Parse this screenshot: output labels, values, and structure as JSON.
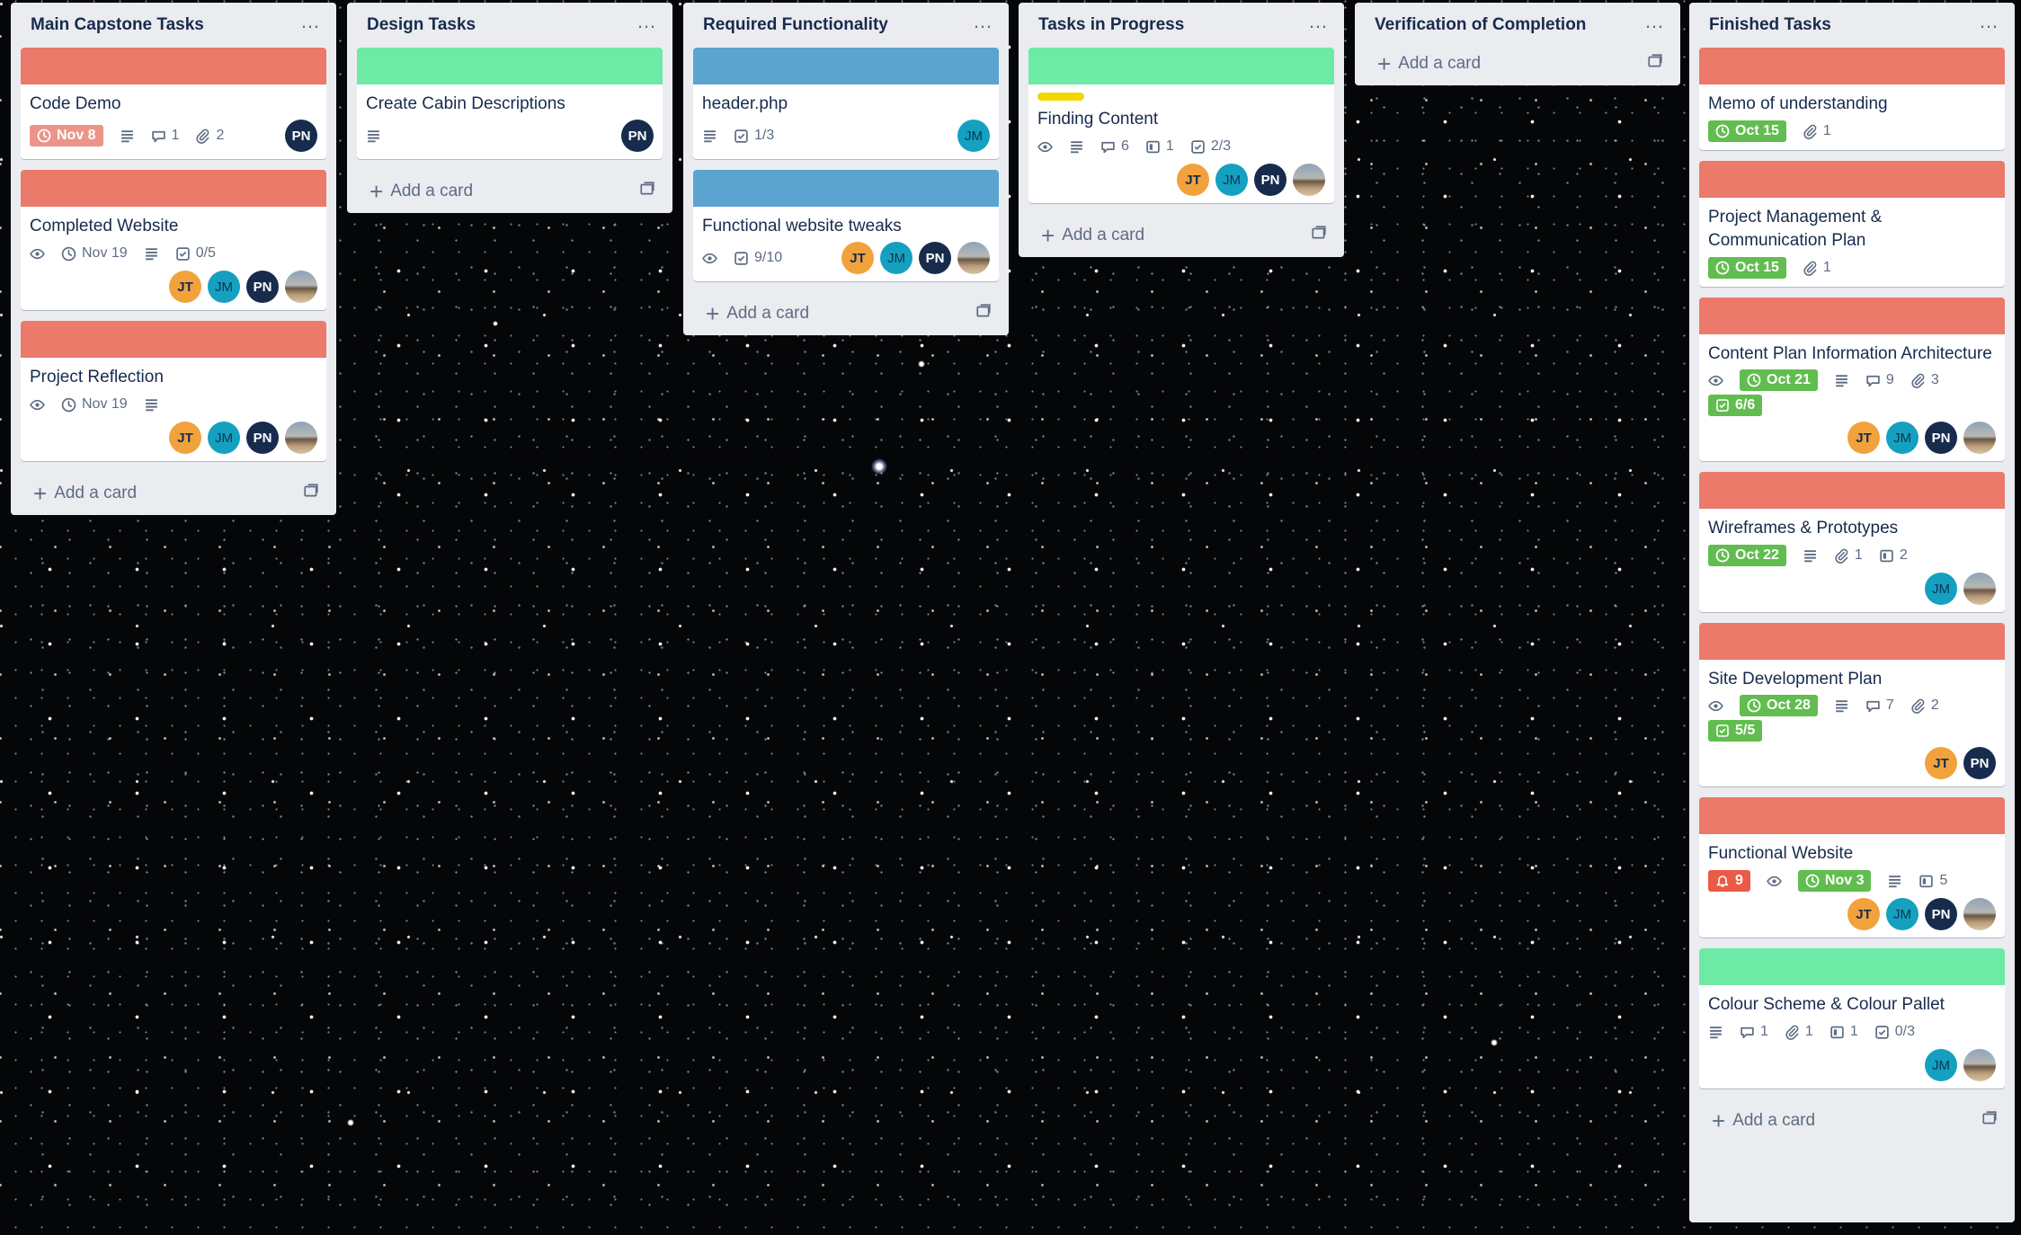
{
  "colors": {
    "label_red": "#eb7a6b",
    "label_green": "#6deaa5",
    "label_blue": "#5ba4cf",
    "label_yellow": "#f2d600",
    "due_green": "#61bd4f",
    "due_overdue": "#ec9488",
    "alert_red": "#eb5a46"
  },
  "add_card_label": "Add a card",
  "list_menu_label": "…",
  "lists": [
    {
      "title": "Main Capstone Tasks",
      "cards": [
        {
          "title": "Code Demo",
          "cover": "red",
          "due": "Nov 8",
          "comments": "1",
          "attachments": "2",
          "members": [
            "PN"
          ]
        },
        {
          "title": "Completed Website",
          "cover": "red",
          "due": "Nov 19",
          "checklist": "0/5",
          "members": [
            "JT",
            "JM",
            "PN",
            "photo"
          ]
        },
        {
          "title": "Project Reflection",
          "cover": "red",
          "due": "Nov 19",
          "members": [
            "JT",
            "JM",
            "PN",
            "photo"
          ]
        }
      ]
    },
    {
      "title": "Design Tasks",
      "cards": [
        {
          "title": "Create Cabin Descriptions",
          "cover": "green",
          "members": [
            "PN"
          ]
        }
      ]
    },
    {
      "title": "Required Functionality",
      "cards": [
        {
          "title": "header.php",
          "cover": "blue",
          "checklist": "1/3",
          "members": [
            "JM"
          ]
        },
        {
          "title": "Functional website tweaks",
          "cover": "blue",
          "checklist": "9/10",
          "members": [
            "JT",
            "JM",
            "PN",
            "photo"
          ]
        }
      ]
    },
    {
      "title": "Tasks in Progress",
      "cards": [
        {
          "title": "Finding Content",
          "cover": "green",
          "label": "yellow",
          "comments": "6",
          "trello_cards": "1",
          "checklist": "2/3",
          "members": [
            "JT",
            "JM",
            "PN",
            "photo"
          ]
        }
      ]
    },
    {
      "title": "Verification of Completion",
      "cards": []
    },
    {
      "title": "Finished Tasks",
      "cards": [
        {
          "title": "Memo of understanding",
          "cover": "red",
          "due": "Oct 15",
          "attachments": "1"
        },
        {
          "title": "Project Management & Communication Plan",
          "cover": "red",
          "due": "Oct 15",
          "attachments": "1"
        },
        {
          "title": "Content Plan Information Architecture",
          "cover": "red",
          "due": "Oct 21",
          "comments": "9",
          "attachments": "3",
          "checklist": "6/6",
          "members": [
            "JT",
            "JM",
            "PN",
            "photo"
          ]
        },
        {
          "title": "Wireframes & Prototypes",
          "cover": "red",
          "due": "Oct 22",
          "attachments": "1",
          "trello_cards": "2",
          "members": [
            "JM",
            "photo"
          ]
        },
        {
          "title": "Site Development Plan",
          "cover": "red",
          "due": "Oct 28",
          "comments": "7",
          "attachments": "2",
          "checklist": "5/5",
          "members": [
            "JT",
            "PN"
          ]
        },
        {
          "title": "Functional Website",
          "cover": "red",
          "alerts": "9",
          "due": "Nov 3",
          "trello_cards": "5",
          "members": [
            "JT",
            "JM",
            "PN",
            "photo"
          ]
        },
        {
          "title": "Colour Scheme & Colour Pallet",
          "cover": "green",
          "comments": "1",
          "attachments": "1",
          "trello_cards": "1",
          "checklist": "0/3",
          "members": [
            "JM",
            "photo"
          ]
        }
      ]
    }
  ]
}
